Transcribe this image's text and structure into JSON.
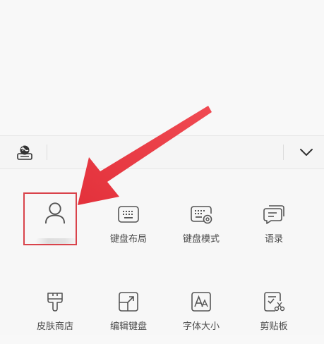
{
  "toolbar": {
    "logo_icon": "keyboard-globe-icon",
    "collapse_icon": "chevron-down-icon"
  },
  "grid": {
    "row1": [
      {
        "id": "profile",
        "label": "",
        "icon": "user-icon"
      },
      {
        "id": "keyboard-layout",
        "label": "键盘布局",
        "icon": "keyboard-icon"
      },
      {
        "id": "keyboard-mode",
        "label": "键盘模式",
        "icon": "keyboard-settings-icon"
      },
      {
        "id": "phrases",
        "label": "语录",
        "icon": "chat-bubble-icon"
      }
    ],
    "row2": [
      {
        "id": "skin-store",
        "label": "皮肤商店",
        "icon": "paint-brush-icon"
      },
      {
        "id": "edit-keyboard",
        "label": "编辑键盘",
        "icon": "edit-resize-icon"
      },
      {
        "id": "font-size",
        "label": "字体大小",
        "icon": "font-size-icon"
      },
      {
        "id": "clipboard",
        "label": "剪贴板",
        "icon": "clipboard-scissors-icon"
      }
    ]
  },
  "annotation": {
    "highlight_color": "#d9434b",
    "arrow_color": "#e5343d"
  }
}
